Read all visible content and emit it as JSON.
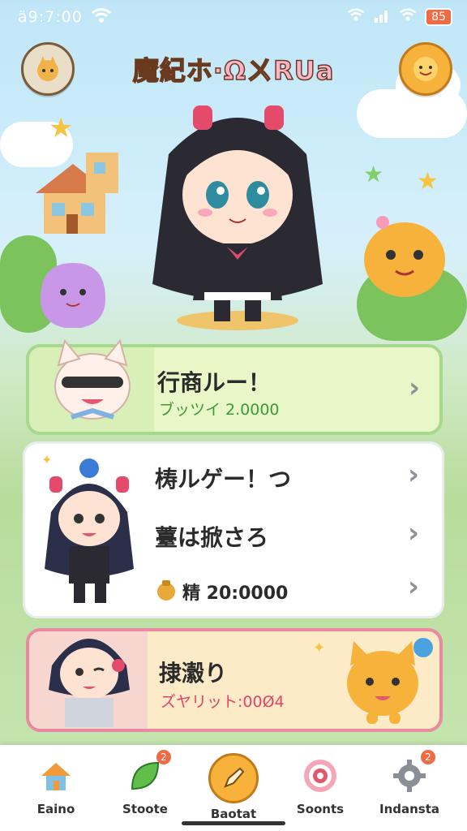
{
  "status": {
    "time": "ä9:7:00",
    "battery": "85"
  },
  "header": {
    "title": "魔紀ホ·ΩㄨRUa"
  },
  "cards": [
    {
      "title": "行商ルー！",
      "subtitle": "ブッツイ 2.0000"
    },
    {
      "rows": [
        {
          "title": "梼ルゲー！つ"
        },
        {
          "title": "薹は掀さろ"
        },
        {
          "title": "精 20:0000"
        }
      ]
    },
    {
      "title": "捸瀫り",
      "subtitle": "ズヤリット:00Ø4"
    }
  ],
  "nav": [
    {
      "label": "Eaino",
      "icon": "home-icon"
    },
    {
      "label": "Stoote",
      "icon": "leaf-icon",
      "badge": "2"
    },
    {
      "label": "Baotat",
      "icon": "pencil-icon"
    },
    {
      "label": "Soonts",
      "icon": "target-icon"
    },
    {
      "label": "Indansta",
      "icon": "gear-icon",
      "badge": "2"
    }
  ],
  "colors": {
    "accent": "#ef6b43",
    "card1_border": "#a6d98d",
    "card3_border": "#e98aa0"
  }
}
